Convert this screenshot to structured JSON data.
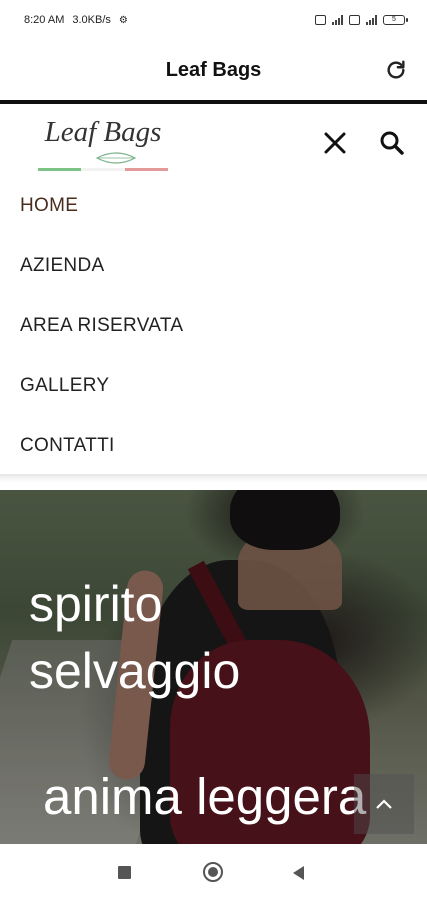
{
  "status_bar": {
    "time": "8:20 AM",
    "speed": "3.0KB/s",
    "battery": "5"
  },
  "app_bar": {
    "title": "Leaf Bags"
  },
  "site_header": {
    "logo_text": "Leaf Bags",
    "stripe_colors": [
      "#6fbf73",
      "#ffffff",
      "#e48a8a"
    ]
  },
  "nav": {
    "items": [
      {
        "label": "HOME",
        "active": true
      },
      {
        "label": "AZIENDA"
      },
      {
        "label": "AREA RISERVATA"
      },
      {
        "label": "GALLERY"
      },
      {
        "label": "CONTATTI"
      }
    ]
  },
  "hero": {
    "line1": "spirito",
    "line2": "selvaggio",
    "line3": "anima leggera"
  },
  "colors": {
    "nav_active": "#4a2d1f",
    "divider": "#111111"
  }
}
